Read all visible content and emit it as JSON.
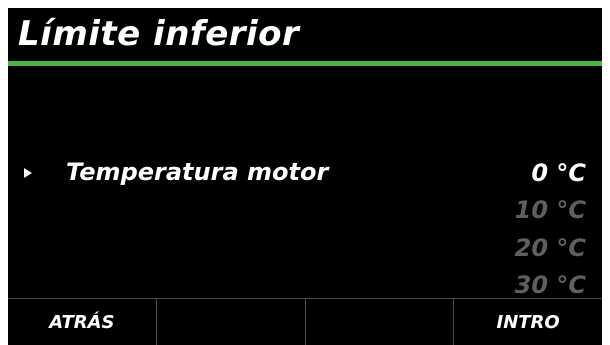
{
  "header": {
    "title": "Límite inferior"
  },
  "colors": {
    "accent": "#4cb447",
    "background": "#000000",
    "text": "#ffffff",
    "dim_text": "#5f5f5f"
  },
  "parameter": {
    "label": "Temperatura motor",
    "selected_value": "0 °C",
    "other_values": [
      "10 °C",
      "20 °C",
      "30 °C"
    ]
  },
  "softkeys": {
    "left": "ATRÁS",
    "middle_left": "",
    "middle_right": "",
    "right": "INTRO"
  },
  "icons": {
    "selection": "right-triangle-icon"
  }
}
